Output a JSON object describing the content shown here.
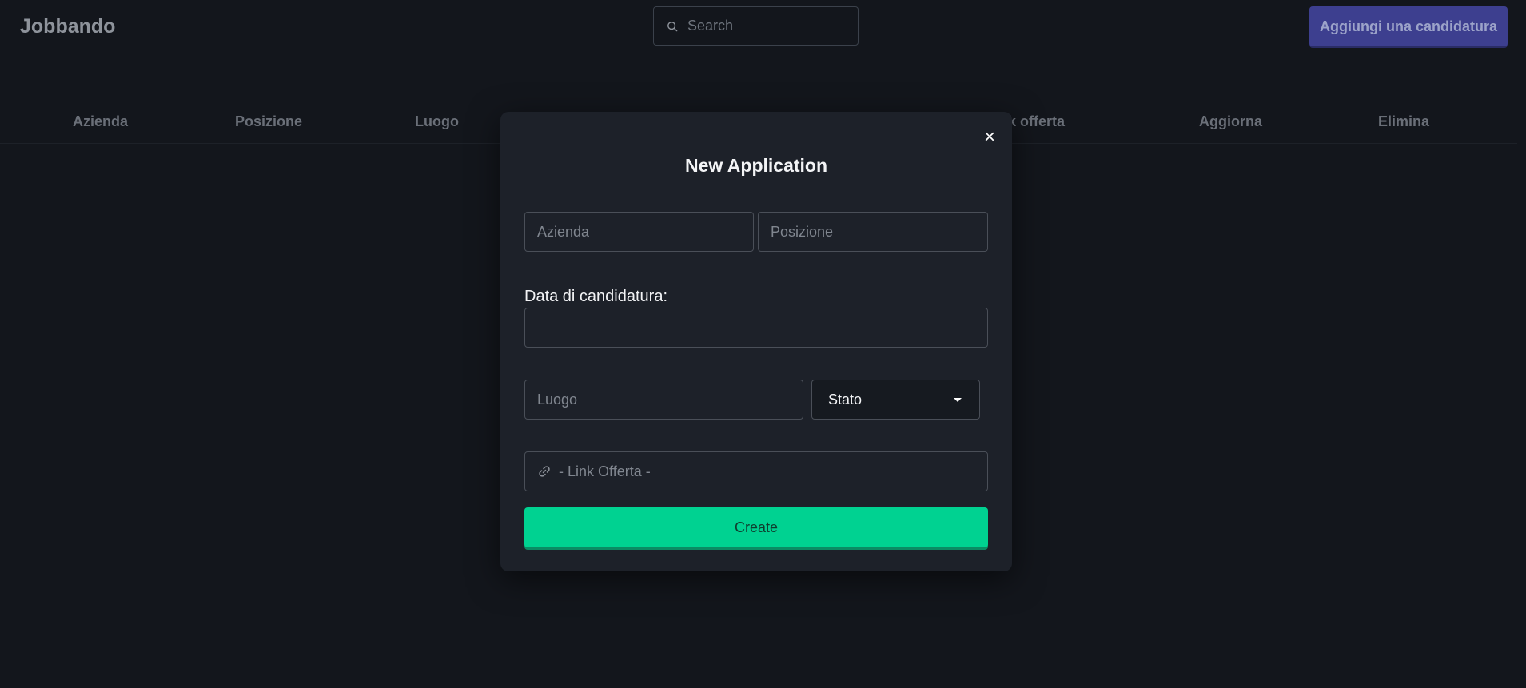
{
  "app": {
    "brand": "Jobbando",
    "search_placeholder": "Search",
    "add_button": "Aggiungi una candidatura"
  },
  "table": {
    "headers": [
      "Azienda",
      "Posizione",
      "Luogo",
      "Link offerta",
      "Aggiorna",
      "Elimina"
    ],
    "visible_header_fragment": "k offerta"
  },
  "modal": {
    "title": "New Application",
    "close": "×",
    "azienda_placeholder": "Azienda",
    "posizione_placeholder": "Posizione",
    "date_label": "Data di candidatura:",
    "date_value": "",
    "luogo_placeholder": "Luogo",
    "stato_selected": "Stato",
    "link_placeholder": "- Link Offerta -",
    "create_button": "Create"
  },
  "colors": {
    "background": "#13161c",
    "modal": "#1d2129",
    "accent": "#3d3f8f",
    "create": "#00d291"
  },
  "icons": {
    "search": "search-icon",
    "link": "link-icon",
    "close": "close-icon",
    "caret": "caret-down-icon"
  }
}
